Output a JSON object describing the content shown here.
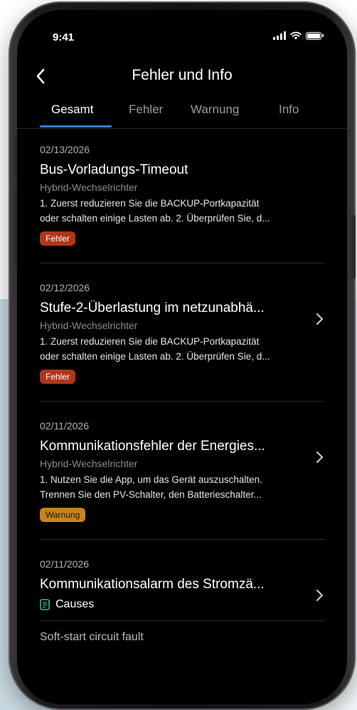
{
  "status_bar": {
    "time": "9:41"
  },
  "header": {
    "title": "Fehler und Info"
  },
  "tabs": [
    {
      "label": "Gesamt",
      "active": true
    },
    {
      "label": "Fehler",
      "active": false
    },
    {
      "label": "Warnung",
      "active": false
    },
    {
      "label": "Info",
      "active": false
    }
  ],
  "items": [
    {
      "date": "02/13/2026",
      "title": "Bus-Vorladungs-Timeout",
      "source": "Hybrid-Wechselrichter",
      "desc_line1": "1. Zuerst reduzieren Sie die BACKUP-Portkapazität",
      "desc_line2": "oder schalten einige Lasten ab. 2. Überprüfen Sie, d...",
      "badge": "Fehler"
    },
    {
      "date": "02/12/2026",
      "title": "Stufe-2-Überlastung im netzunabhä...",
      "source": "Hybrid-Wechselrichter",
      "desc_line1": "1. Zuerst reduzieren Sie die BACKUP-Portkapazität",
      "desc_line2": "oder schalten einige Lasten ab. 2. Überprüfen Sie, d...",
      "badge": "Fehler"
    },
    {
      "date": "02/11/2026",
      "title": "Kommunikationsfehler der Energies...",
      "source": "Hybrid-Wechselrichter",
      "desc_line1": "1. Nutzen Sie die App, um das Gerät auszuschalten.",
      "desc_line2": "Trennen Sie den PV-Schalter, den Batterieschalter...",
      "badge": "Warnung"
    },
    {
      "date": "02/11/2026",
      "title": "Kommunikationsalarm des Stromzä...",
      "causes_label": "Causes"
    }
  ],
  "footer_text": "Soft-start circuit fault",
  "colors": {
    "accent": "#2f7de1",
    "error_badge": "#b0361a",
    "warning_badge": "#c7841b",
    "causes_icon": "#3fb28f"
  }
}
